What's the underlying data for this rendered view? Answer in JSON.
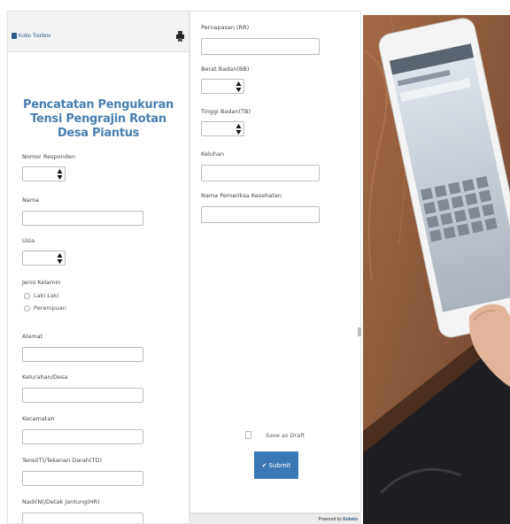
{
  "app": {
    "brand": "Kobo Toolbox"
  },
  "form": {
    "title": "Pencatatan Pengukuran Tensi Pengrajin Rotan Desa Piantus",
    "fields_left": {
      "nomor_responden": {
        "label": "Nomor Responden"
      },
      "nama": {
        "label": "Nama"
      },
      "usia": {
        "label": "Usia"
      },
      "jenis_kelamin": {
        "label": "Jenis Kelamin",
        "options": [
          "Laki Laki",
          "Perempuan"
        ]
      },
      "alamat": {
        "label": "Alamat"
      },
      "kelurahan": {
        "label": "Kelurahan/Desa"
      },
      "kecamatan": {
        "label": "Kecamatan"
      },
      "sistol": {
        "label": "Tensi(T)/Tekanan Darah(TD)"
      },
      "nadi": {
        "label": "Nadi(N)/Detak Jantung(HR)"
      }
    },
    "fields_mid": {
      "pernapasan": {
        "label": "Pernapasan (RR)"
      },
      "berat_badan": {
        "label": "Berat Badan(BB)"
      },
      "tinggi_badan": {
        "label": "Tinggi Badan(TB)"
      },
      "keluhan": {
        "label": "Keluhan"
      },
      "pemeriksa": {
        "label": "Nama Pemeriksa Kesehatan"
      }
    },
    "save_draft_label": "Save as Draft",
    "submit_label": "Submit",
    "submit_icon": "checkmark-icon",
    "powered_by_prefix": "Powered by",
    "powered_by_brand": "Enketo"
  },
  "icons": {
    "print": "print-icon",
    "brand": "kobo-logo-icon"
  },
  "colors": {
    "title": "#4a7fb1",
    "submit": "#3b78b6",
    "brand": "#2d5a8a"
  }
}
